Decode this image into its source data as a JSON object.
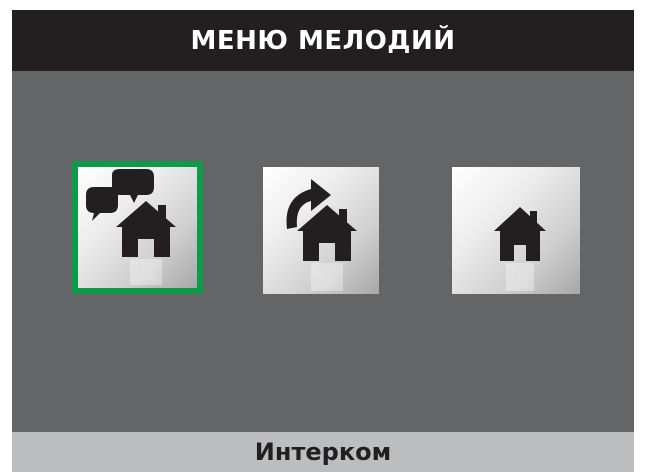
{
  "header": {
    "title": "МЕНЮ МЕЛОДИЙ"
  },
  "menu": {
    "items": [
      {
        "icon": "intercom-house-icon",
        "selected": true
      },
      {
        "icon": "call-forward-house-icon",
        "selected": false
      },
      {
        "icon": "house-icon",
        "selected": false
      }
    ]
  },
  "footer": {
    "label": "Интерком"
  },
  "colors": {
    "header_bg": "#231f20",
    "screen_bg": "#636567",
    "selection_border": "#0e9a48",
    "footer_bg": "#bcbdbf"
  }
}
